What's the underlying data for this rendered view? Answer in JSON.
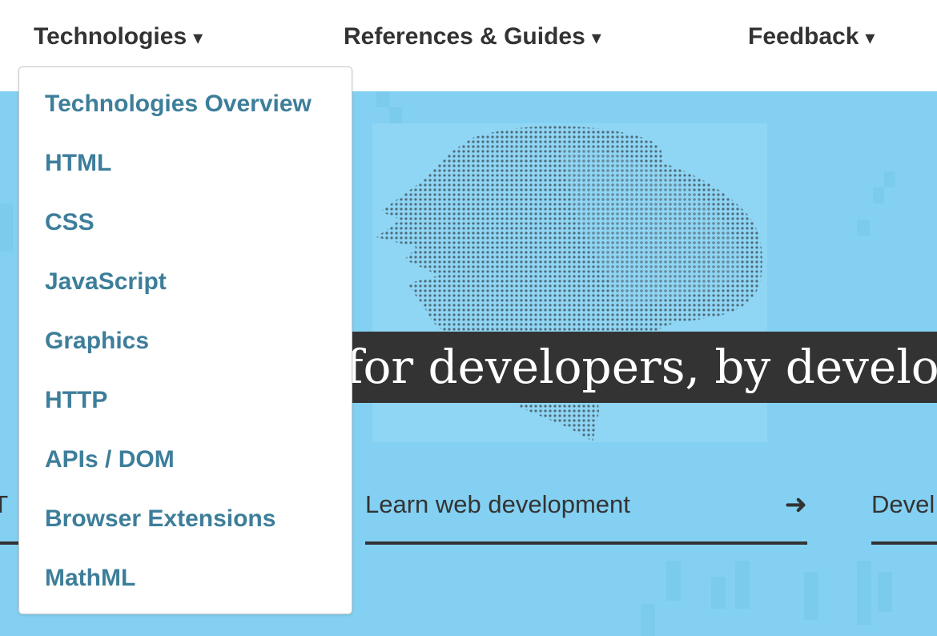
{
  "nav": {
    "technologies": "Technologies",
    "references": "References & Guides",
    "feedback": "Feedback",
    "caret": "▾"
  },
  "dropdown": {
    "items": [
      "Technologies Overview",
      "HTML",
      "CSS",
      "JavaScript",
      "Graphics",
      "HTTP",
      "APIs / DOM",
      "Browser Extensions",
      "MathML"
    ]
  },
  "hero": {
    "tagline": "for developers, by developers",
    "cta_left": "o T",
    "cta_learn": "Learn web development",
    "cta_right": "Devel",
    "arrow": "➜"
  },
  "colors": {
    "hero_background": "#83d0f2",
    "link": "#3d7e9a",
    "text_dark": "#333333"
  },
  "icons": {
    "hero_art": "dinosaur-head-illustration",
    "caret": "caret-down-icon",
    "arrow": "arrow-right-icon"
  }
}
